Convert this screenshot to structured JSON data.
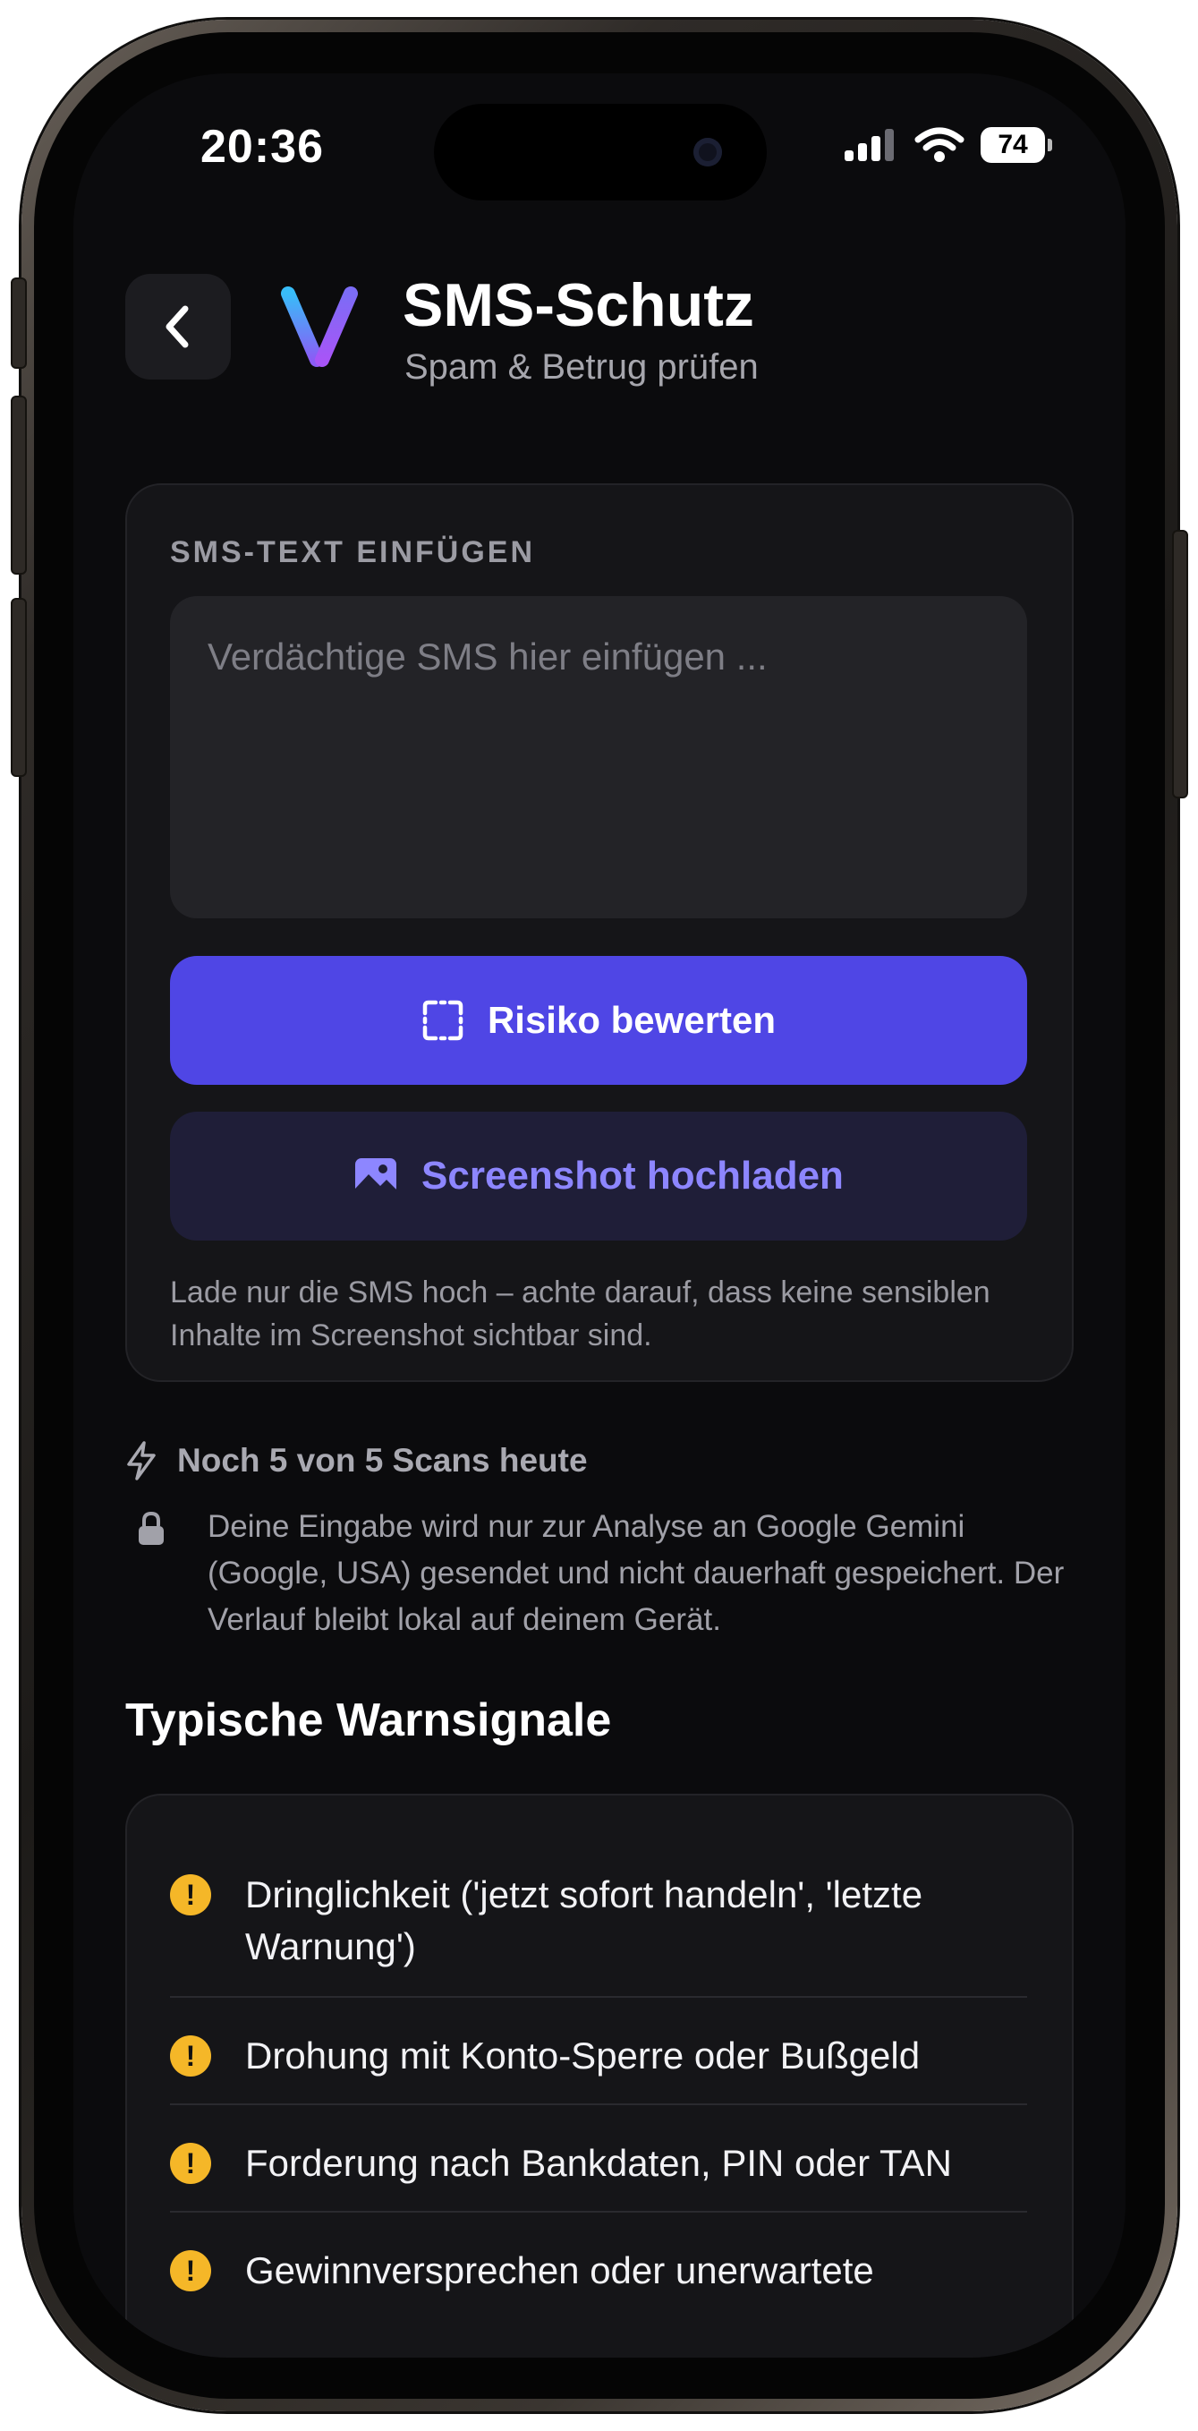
{
  "status_bar": {
    "time": "20:36",
    "battery": "74"
  },
  "header": {
    "title": "SMS-Schutz",
    "subtitle": "Spam & Betrug prüfen"
  },
  "input_card": {
    "section_label": "SMS-TEXT EINFÜGEN",
    "placeholder": "Verdächtige SMS hier einfügen ...",
    "analyze_label": "Risiko bewerten",
    "upload_label": "Screenshot hochladen",
    "hint": "Lade nur die SMS hoch – achte darauf, dass keine sensiblen Inhalte im Screenshot sichtbar sind."
  },
  "usage": {
    "scans_text": "Noch 5 von 5 Scans heute",
    "privacy_text": "Deine Eingabe wird nur zur Analyse an Google Gemini (Google, USA) gesendet und nicht dauerhaft gespeichert. Der Verlauf bleibt lokal auf deinem Gerät."
  },
  "warnings": {
    "title": "Typische Warnsignale",
    "items": [
      "Dringlichkeit ('jetzt sofort handeln', 'letzte Warnung')",
      "Drohung mit Konto-Sperre oder Bußgeld",
      "Forderung nach Bankdaten, PIN oder TAN",
      "Gewinnversprechen oder unerwartete"
    ]
  },
  "colors": {
    "accent": "#4f46e5",
    "accent_soft": "#8d86ff",
    "warning": "#f5b728",
    "background": "#0b0b0d"
  },
  "icons": {
    "back": "chevron-left-icon",
    "scan": "scan-frame-icon",
    "upload": "image-icon",
    "scans": "bolt-icon",
    "privacy": "lock-icon",
    "warning": "exclamation-circle-icon"
  }
}
